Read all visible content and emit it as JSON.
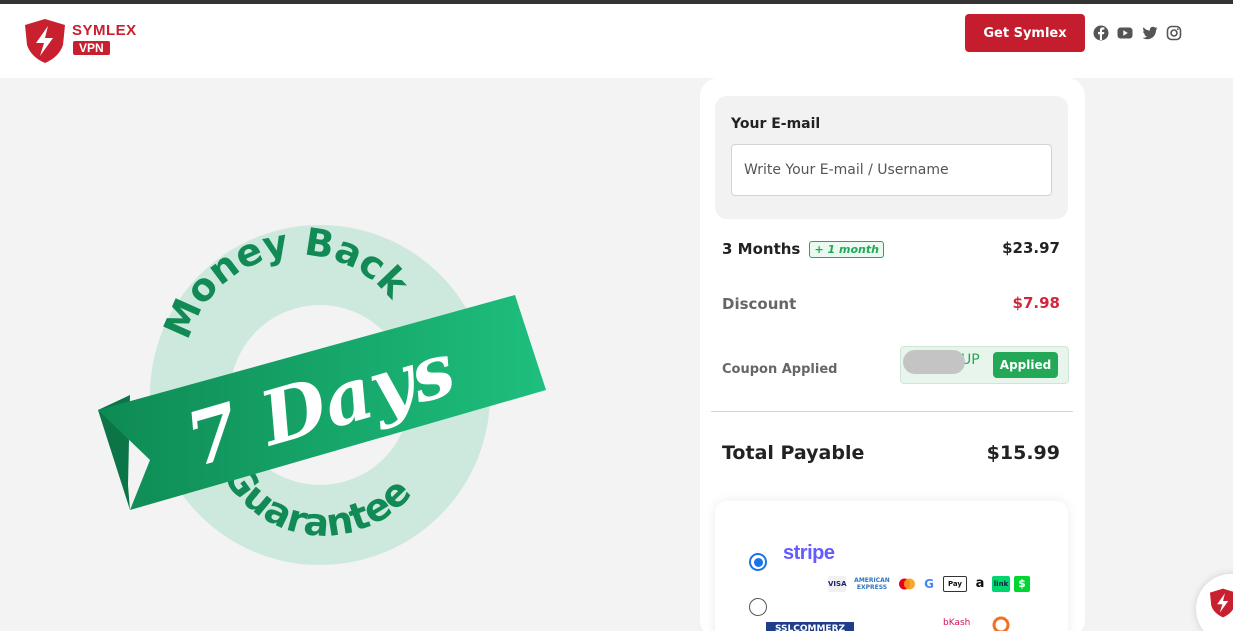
{
  "brand": {
    "name": "SYMLEX",
    "sub": "VPN",
    "color": "#c8202f"
  },
  "header": {
    "cta_label": "Get Symlex",
    "social_icons": [
      "facebook-icon",
      "youtube-icon",
      "twitter-icon",
      "instagram-icon"
    ]
  },
  "badge": {
    "top_text": "Money Back",
    "main_text": "7 Days",
    "bottom_text": "Guarantee"
  },
  "checkout": {
    "email_label": "Your E-mail",
    "email_placeholder": "Write Your E-mail / Username",
    "email_value": "",
    "plan_label": "3 Months",
    "plan_bonus": "+ 1 month",
    "plan_price": "$23.97",
    "discount_label": "Discount",
    "discount_value": "$7.98",
    "coupon_label": "Coupon Applied",
    "coupon_code_visible": "UP",
    "coupon_status": "Applied",
    "total_label": "Total Payable",
    "total_value": "$15.99",
    "payment_methods": [
      {
        "name": "stripe",
        "label": "stripe",
        "selected": true
      },
      {
        "name": "sslcommerz",
        "label": "SSLCOMMERZ",
        "selected": false
      }
    ],
    "stripe_cards": [
      "VISA",
      "AMERICAN EXPRESS",
      "mastercard",
      "G",
      "Pay",
      "a",
      "link",
      "$"
    ],
    "local_wallets": [
      "bKash",
      "Nagad"
    ]
  },
  "colors": {
    "accent_red": "#c41e2e",
    "green": "#22a857",
    "stripe_purple": "#635bff"
  }
}
